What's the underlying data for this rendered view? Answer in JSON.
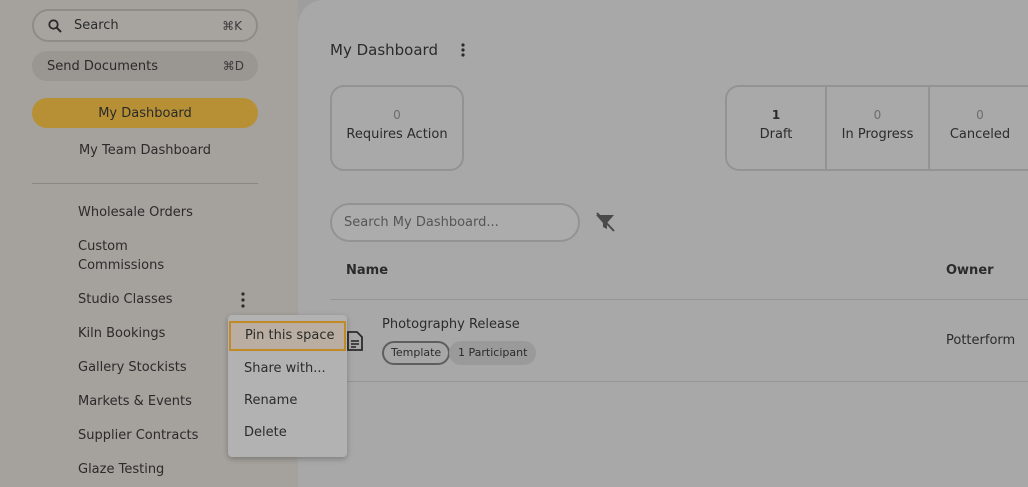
{
  "sidebar": {
    "search": {
      "label": "Search",
      "shortcut": "⌘K"
    },
    "send": {
      "label": "Send Documents",
      "shortcut": "⌘D"
    },
    "my_dashboard": "My Dashboard",
    "team_dashboard": "My Team Dashboard",
    "spaces": [
      {
        "label": "Wholesale Orders"
      },
      {
        "label": "Custom\nCommissions"
      },
      {
        "label": "Studio Classes"
      },
      {
        "label": "Kiln Bookings"
      },
      {
        "label": "Gallery Stockists"
      },
      {
        "label": "Markets & Events"
      },
      {
        "label": "Supplier Contracts"
      },
      {
        "label": "Glaze Testing"
      }
    ]
  },
  "context_menu": {
    "items": [
      "Pin this space",
      "Share with...",
      "Rename",
      "Delete"
    ]
  },
  "main": {
    "title": "My Dashboard",
    "stats": {
      "requires_action": {
        "count": "0",
        "label": "Requires Action"
      },
      "draft": {
        "count": "1",
        "label": "Draft"
      },
      "in_progress": {
        "count": "0",
        "label": "In Progress"
      },
      "canceled": {
        "count": "0",
        "label": "Canceled"
      }
    },
    "search_placeholder": "Search My Dashboard...",
    "table": {
      "columns": {
        "name": "Name",
        "owner": "Owner"
      },
      "rows": [
        {
          "title": "Photography Release",
          "tags": [
            "Template",
            "1 Participant"
          ],
          "owner": "Potterform"
        }
      ]
    }
  }
}
